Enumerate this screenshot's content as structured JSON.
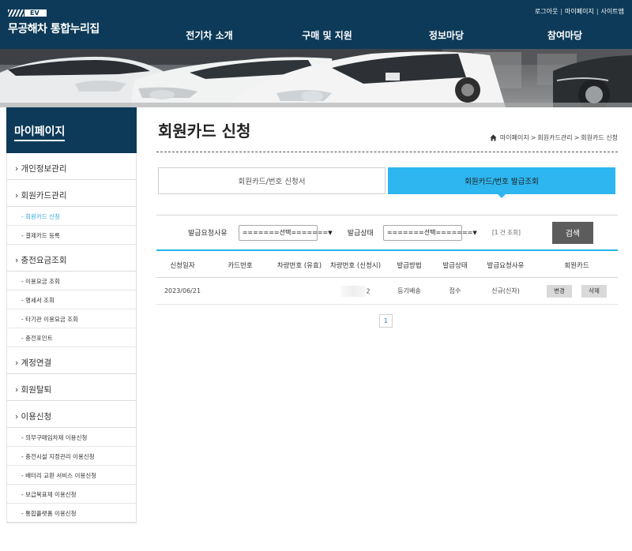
{
  "header": {
    "logo_badge": "EV",
    "logo_text": "무공해차 통합누리집",
    "util_links": [
      "로그아웃",
      "마이페이지",
      "사이트맵"
    ],
    "util_separator": "|",
    "nav": [
      "전기차 소개",
      "구매 및 지원",
      "정보마당",
      "참여마당"
    ]
  },
  "sidebar": {
    "title": "마이페이지",
    "items": [
      {
        "label": "› 개인정보관리",
        "level": 1
      },
      {
        "label": "› 회원카드관리",
        "level": 1
      },
      {
        "label": "- 회원카드 신청",
        "level": 2,
        "active": true
      },
      {
        "label": "- 결제카드 등록",
        "level": 2
      },
      {
        "label": "› 충전요금조회",
        "level": 1
      },
      {
        "label": "- 이용요금 조회",
        "level": 2
      },
      {
        "label": "- 명세서 조회",
        "level": 2
      },
      {
        "label": "- 타기관 이용요금 조회",
        "level": 2
      },
      {
        "label": "- 충전포인트",
        "level": 2
      },
      {
        "label": "› 계정연결",
        "level": 1
      },
      {
        "label": "› 회원탈퇴",
        "level": 1
      },
      {
        "label": "› 이용신청",
        "level": 1
      },
      {
        "label": "- 의무구매임차제 이용신청",
        "level": 2
      },
      {
        "label": "- 충전시설 지정관리 이용신청",
        "level": 2
      },
      {
        "label": "- 배터리 교환 서비스 이용신청",
        "level": 2
      },
      {
        "label": "- 보급목표제 이용신청",
        "level": 2
      },
      {
        "label": "- 통합플랫폼 이용신청",
        "level": 2
      }
    ]
  },
  "main": {
    "title": "회원카드 신청",
    "breadcrumb": [
      "마이페이지",
      "회원카드관리",
      "회원카드 신청"
    ],
    "breadcrumb_separator": ">",
    "tabs": [
      {
        "label": "회원카드/번호 신청서",
        "active": false
      },
      {
        "label": "회원카드/번호 발급조회",
        "active": true
      }
    ],
    "search": {
      "reason_label": "발급요청사유",
      "reason_value": "=======선택=======",
      "status_label": "발급상태",
      "status_value": "=======선택=======",
      "count_text": "[1 건 조회]",
      "button_label": "검색"
    },
    "table": {
      "headers": [
        "신청일자",
        "카드번호",
        "차량번호 (유효)",
        "차량번호 (신청시)",
        "발급방법",
        "발급상태",
        "발급요청사유",
        "회원카드"
      ],
      "rows": [
        {
          "date": "2023/06/21",
          "card_no": "",
          "car_valid": "",
          "car_applied_suffix": "2",
          "method": "등기배송",
          "status": "접수",
          "reason": "신규(신차)",
          "btn_change": "변경",
          "btn_delete": "삭제"
        }
      ]
    },
    "pagination": {
      "current": "1"
    }
  },
  "colors": {
    "header_bg": "#0d3a58",
    "accent": "#2db6ef",
    "active_link": "#2fa7d9",
    "search_button": "#5c5c5c"
  }
}
